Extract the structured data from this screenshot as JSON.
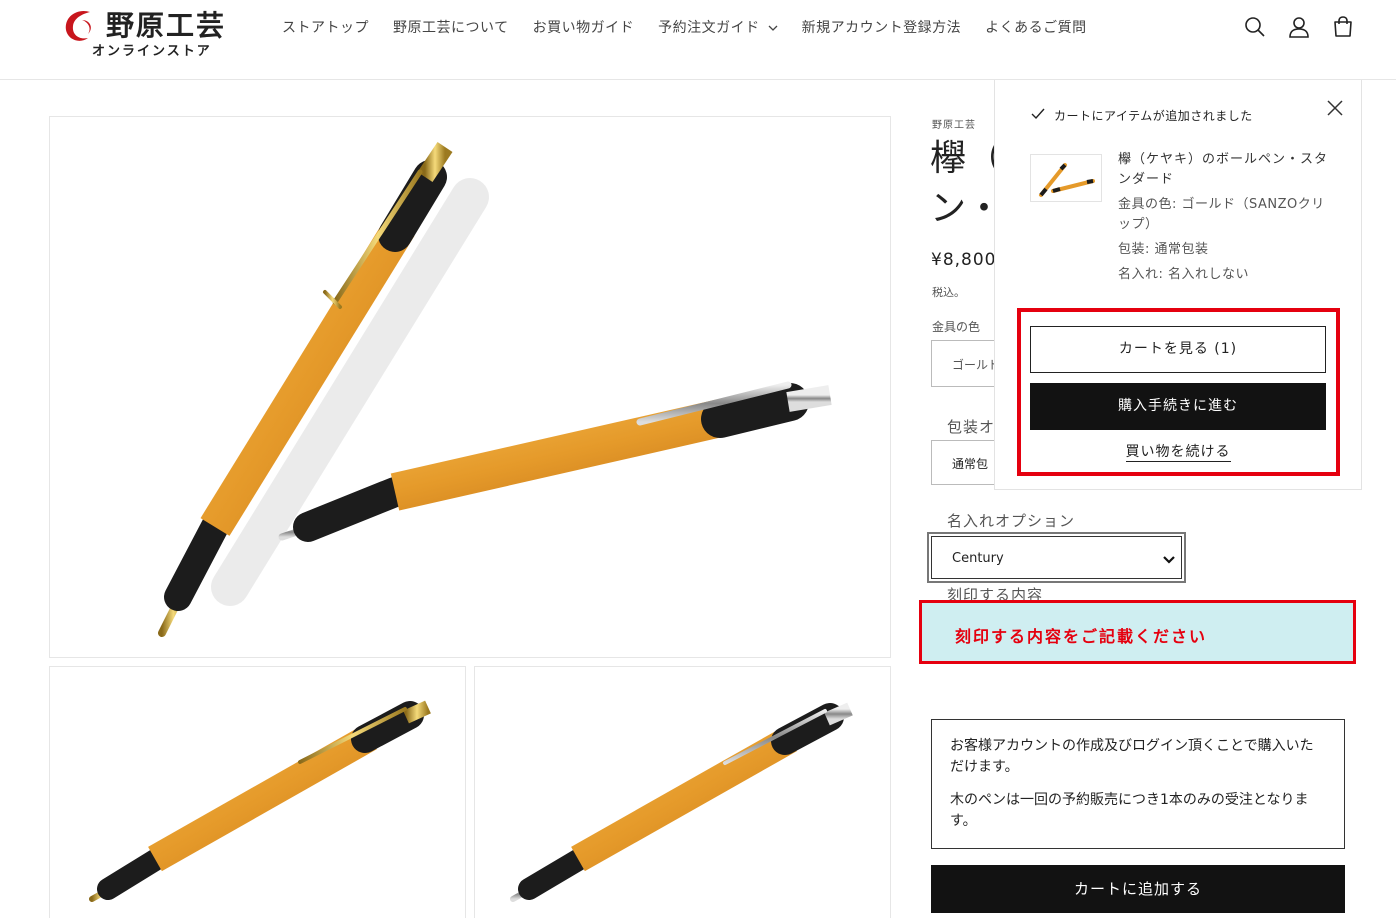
{
  "header": {
    "logo_main": "野原工芸",
    "logo_sub": "オンラインストア",
    "nav": [
      {
        "label": "ストアトップ"
      },
      {
        "label": "野原工芸について"
      },
      {
        "label": "お買い物ガイド"
      },
      {
        "label": "予約注文ガイド"
      },
      {
        "label": "新規アカウント登録方法"
      },
      {
        "label": "よくあるご質問"
      }
    ],
    "icons": [
      "search-icon",
      "account-icon",
      "cart-icon"
    ]
  },
  "product": {
    "vendor": "野原工芸",
    "title": "欅（ケヤキ）のボールペン・スタンダード",
    "price": "¥8,800",
    "tax_note": "税込。",
    "color_label": "金具の色",
    "color_value": "ゴールド",
    "wrap_label": "包装オ",
    "wrap_value": "通常包",
    "name_label": "名入れオプション",
    "name_font_value": "Century",
    "engrave_label": "刻印する内容",
    "engrave_placeholder": "刻印する内容をご記載ください",
    "notice_1": "お客様アカウントの作成及びログイン頂くことで購入いただけます。",
    "notice_2": "木のペンは一回の予約販売につき1本のみの受注となります。",
    "add_to_cart": "カートに追加する"
  },
  "popup": {
    "title": "カートにアイテムが追加されました",
    "item_name": "欅（ケヤキ）のボールペン・スタンダード",
    "attr_color": "金具の色: ゴールド（SANZOクリップ）",
    "attr_wrap": "包装: 通常包装",
    "attr_name": "名入れ: 名入れしない",
    "view_cart": "カートを見る (1)",
    "checkout": "購入手続きに進む",
    "continue": "買い物を続ける"
  },
  "colors": {
    "accent_red": "#e5000f",
    "engrave_bg": "#cfeef1",
    "button_dark": "#121212"
  }
}
